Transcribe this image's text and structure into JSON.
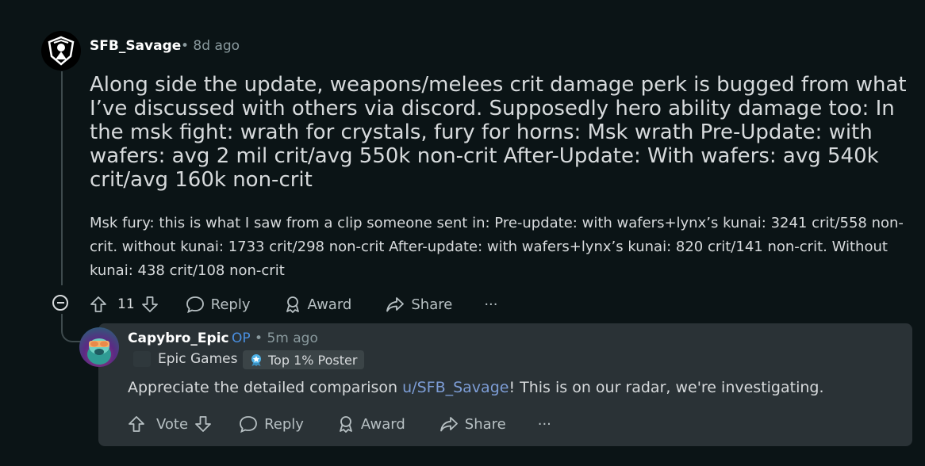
{
  "parent": {
    "author": "SFB_Savage",
    "time": "• 8d ago",
    "body_paragraph_1": "Along side the update, weapons/melees crit damage perk is bugged from what I’ve discussed with others via discord. Supposedly hero ability damage too: In the msk fight: wrath for crystals, fury for horns: Msk wrath Pre-Update: with wafers: avg 2 mil crit/avg 550k non-crit After-Update: With wafers: avg 540k crit/avg 160k non-crit",
    "body_paragraph_2": "Msk fury: this is what I saw from a clip someone sent in: Pre-update: with wafers+lynx’s kunai: 3241 crit/558 non-crit. without kunai: 1733 crit/298 non-crit After-update: with wafers+lynx’s kunai: 820 crit/141 non-crit. Without kunai: 438 crit/108 non-crit",
    "actions": {
      "vote_count": "11",
      "reply": "Reply",
      "award": "Award",
      "share": "Share",
      "more": "···"
    }
  },
  "reply": {
    "author": "Capybro_Epic",
    "op_label": "OP",
    "time": "• 5m ago",
    "flair": "Epic Games",
    "badge": "Top 1% Poster",
    "text_before": "Appreciate the detailed comparison ",
    "mention": "u/SFB_Savage",
    "text_after": "! This is on our radar, we're investigating.",
    "actions": {
      "vote": "Vote",
      "reply": "Reply",
      "award": "Award",
      "share": "Share",
      "more": "···"
    }
  },
  "colors": {
    "background": "#0b1416",
    "reply_card": "#2a3236",
    "op_blue": "#4a90e2",
    "mention": "#7d9dd6"
  }
}
